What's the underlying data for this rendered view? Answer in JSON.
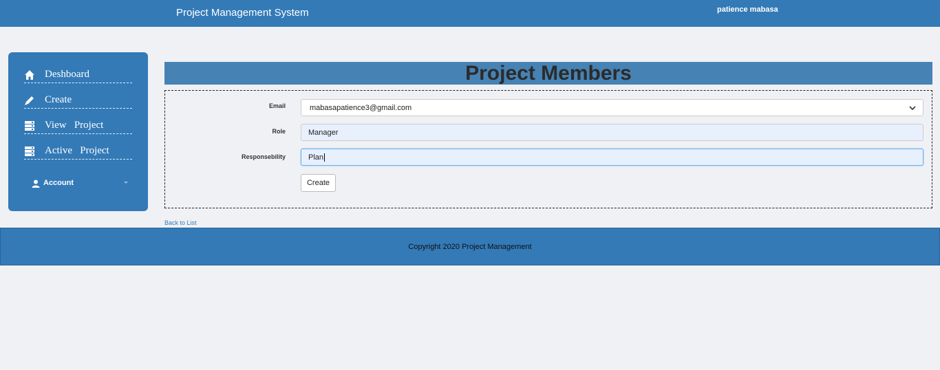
{
  "header": {
    "app_title": "Project Management System",
    "user_name": "patience mabasa"
  },
  "sidebar": {
    "items": [
      {
        "label": "Deshboard",
        "icon": "home-icon"
      },
      {
        "label": "Create",
        "icon": "pencil-icon"
      },
      {
        "label": "View   Project",
        "icon": "server-icon"
      },
      {
        "label": "Active   Project",
        "icon": "server-icon"
      }
    ],
    "account": {
      "label": "Account",
      "icon": "user-icon"
    }
  },
  "main": {
    "title": "Project Members",
    "form": {
      "email_label": "Email",
      "email_value": "mabasapatience3@gmail.com",
      "role_label": "Role",
      "role_value": "Manager",
      "responsibility_label": "Responsebility",
      "responsibility_value": "Plan",
      "create_label": "Create"
    },
    "back_link": "Back to List"
  },
  "footer": {
    "copyright": "Copyright 2020 Project Management"
  },
  "colors": {
    "primary": "#337ab7",
    "header_band": "#4682b4",
    "background": "#f0f1f4"
  }
}
